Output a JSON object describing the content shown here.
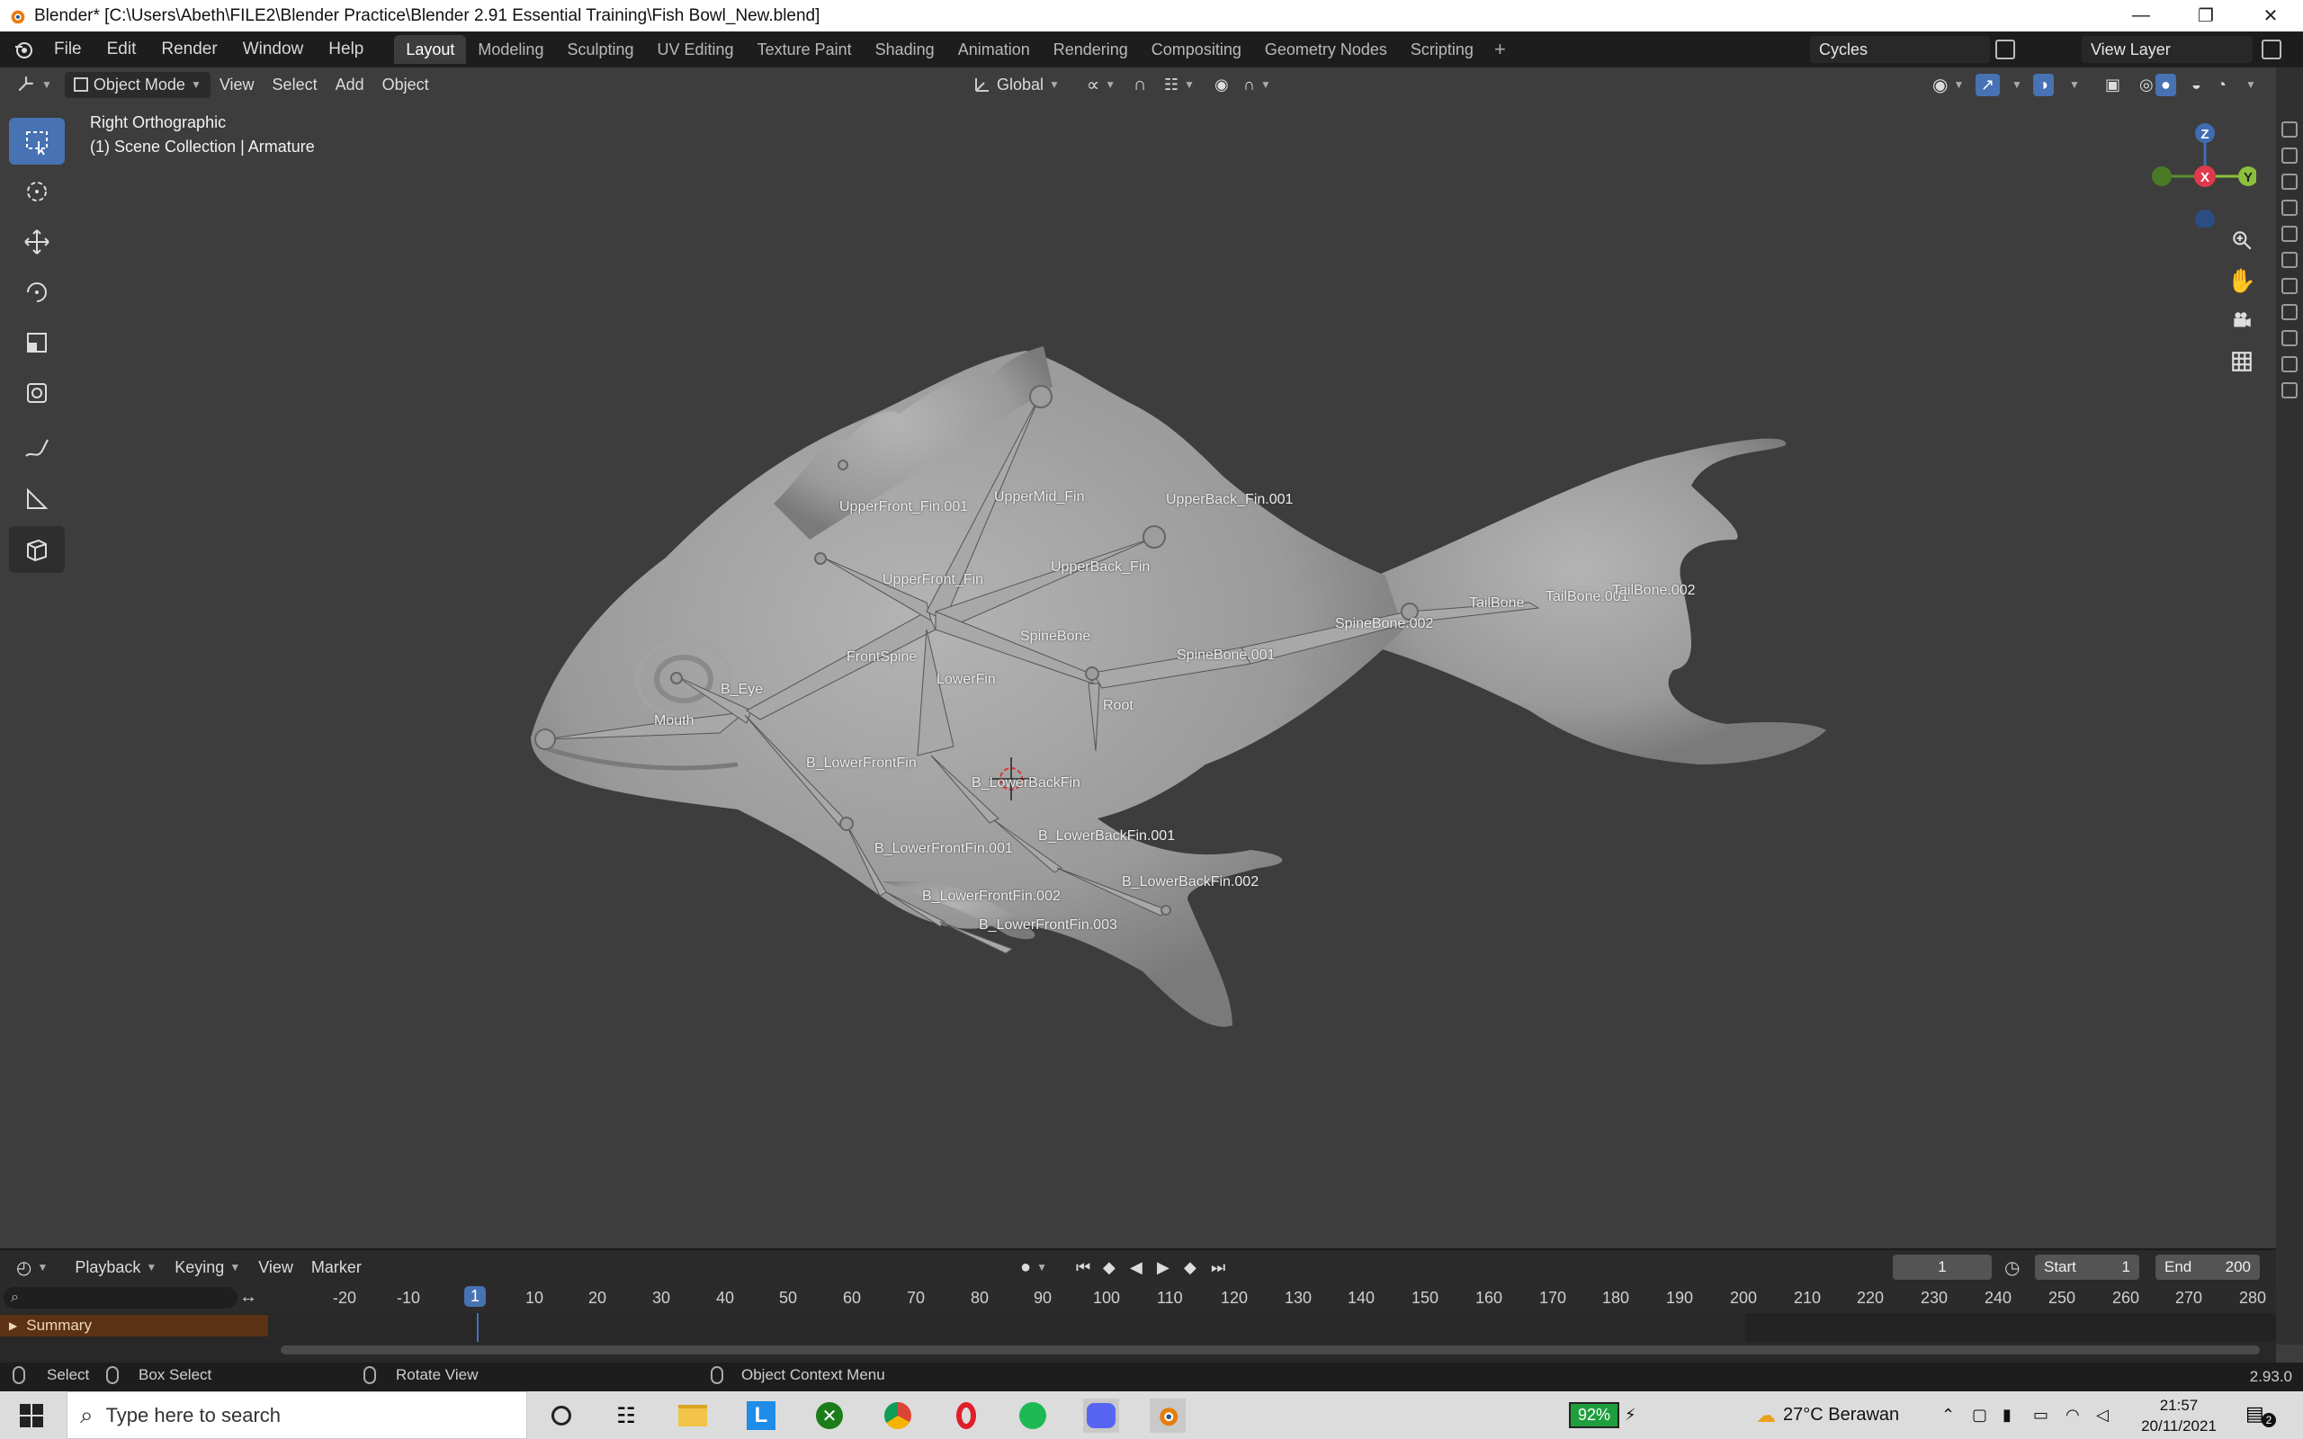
{
  "window": {
    "title": "Blender* [C:\\Users\\Abeth\\FILE2\\Blender Practice\\Blender 2.91 Essential Training\\Fish Bowl_New.blend]"
  },
  "menus": [
    "File",
    "Edit",
    "Render",
    "Window",
    "Help"
  ],
  "workspaces": [
    "Layout",
    "Modeling",
    "Sculpting",
    "UV Editing",
    "Texture Paint",
    "Shading",
    "Animation",
    "Rendering",
    "Compositing",
    "Geometry Nodes",
    "Scripting"
  ],
  "active_workspace": "Layout",
  "render_engine": "Cycles",
  "view_layer": "View Layer",
  "viewport_header": {
    "mode": "Object Mode",
    "view": "View",
    "select": "Select",
    "add": "Add",
    "object": "Object",
    "orientation": "Global"
  },
  "viewport": {
    "view_name": "Right Orthographic",
    "collection": "(1) Scene Collection | Armature",
    "gizmo_axes": {
      "z": "Z",
      "x": "X",
      "y": "Y"
    }
  },
  "bones": [
    "UpperFront_Fin.001",
    "UpperMid_Fin",
    "UpperBack_Fin.001",
    "UpperFront_Fin",
    "UpperBack_Fin",
    "SpineBone",
    "FrontSpine",
    "SpineBone.001",
    "SpineBone.002",
    "TailBone",
    "TailBone.001",
    "TailBone.002",
    "B_Eye",
    "Mouth",
    "LowerFin",
    "Root",
    "B_LowerFrontFin",
    "B_LowerBackFin",
    "B_LowerBackFin.001",
    "B_LowerFrontFin.001",
    "B_LowerBackFin.002",
    "B_LowerFrontFin.002",
    "B_LowerFrontFin.003"
  ],
  "timeline": {
    "playback": "Playback",
    "keying": "Keying",
    "view": "View",
    "marker": "Marker",
    "current_frame": "1",
    "start_label": "Start",
    "start": "1",
    "end_label": "End",
    "end": "200",
    "ticks": [
      "-20",
      "-10",
      "1",
      "10",
      "20",
      "30",
      "40",
      "50",
      "60",
      "70",
      "80",
      "90",
      "100",
      "110",
      "120",
      "130",
      "140",
      "150",
      "160",
      "170",
      "180",
      "190",
      "200",
      "210",
      "220",
      "230",
      "240",
      "250",
      "260",
      "270",
      "280"
    ],
    "summary": "Summary"
  },
  "statusbar": {
    "select": "Select",
    "box_select": "Box Select",
    "rotate_view": "Rotate View",
    "context_menu": "Object Context Menu",
    "version": "2.93.0"
  },
  "taskbar": {
    "search_placeholder": "Type here to search",
    "battery": "92%",
    "weather": "27°C  Berawan",
    "time": "21:57",
    "date": "20/11/2021",
    "notifications": "2"
  },
  "colors": {
    "accent": "#4772b3",
    "viewport_bg": "#3d3d3d",
    "summary_bg": "#5c3214",
    "battery_green": "#1e9e3c"
  }
}
